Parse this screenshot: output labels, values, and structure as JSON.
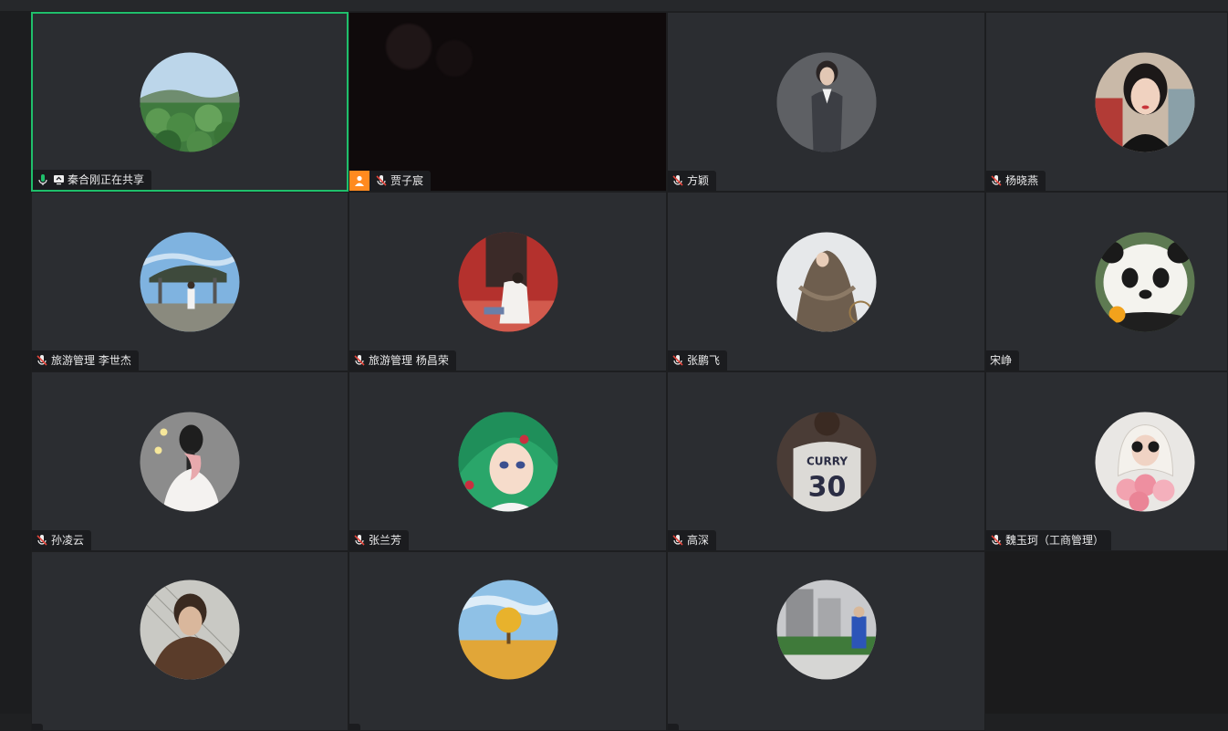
{
  "participants": [
    {
      "name": "秦合刚正在共享",
      "mic": "on",
      "sharing": true
    },
    {
      "name": "贾子宸",
      "mic": "muted",
      "video": true
    },
    {
      "name": "方颖",
      "mic": "muted"
    },
    {
      "name": "杨晓燕",
      "mic": "muted"
    },
    {
      "name": "旅游管理 李世杰",
      "mic": "muted"
    },
    {
      "name": "旅游管理 杨昌荣",
      "mic": "muted"
    },
    {
      "name": "张鹏飞",
      "mic": "muted"
    },
    {
      "name": "宋峥",
      "mic": "none"
    },
    {
      "name": "孙凌云",
      "mic": "muted"
    },
    {
      "name": "张兰芳",
      "mic": "muted"
    },
    {
      "name": "高深",
      "mic": "muted"
    },
    {
      "name": "魏玉珂（工商管理）",
      "mic": "muted"
    },
    {
      "name": "",
      "mic": "muted"
    },
    {
      "name": "",
      "mic": "muted"
    },
    {
      "name": "",
      "mic": "muted"
    }
  ],
  "jersey": {
    "name": "CURRY",
    "number": "30"
  },
  "colors": {
    "active_border": "#1fbf6b",
    "tile_bg": "#2b2d31",
    "label_bg": "#1b1c1f",
    "mic_on": "#1fbf6b",
    "mic_muted": "#e2453c",
    "badge": "#ff8a1f"
  }
}
